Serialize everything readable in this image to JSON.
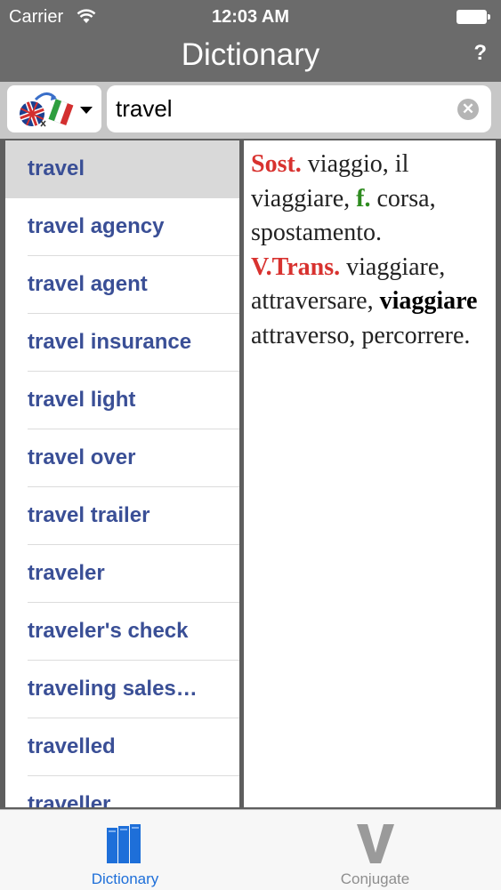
{
  "status": {
    "carrier": "Carrier",
    "time": "12:03 AM"
  },
  "nav": {
    "title": "Dictionary",
    "help_label": "?"
  },
  "search": {
    "value": "travel",
    "clear_label": "✕"
  },
  "word_list": [
    "travel",
    "travel agency",
    "travel agent",
    "travel insurance",
    "travel light",
    "travel over",
    "travel trailer",
    "traveler",
    "traveler's check",
    "traveling sales…",
    "travelled",
    "traveller"
  ],
  "definition": {
    "pos1": "Sost.",
    "text1": " viaggio, il viaggiare, ",
    "gender": "f.",
    "text2": " corsa, spostamento.",
    "pos2": "V.Trans.",
    "text3": " viaggiare, attraversare, ",
    "bold_phrase": "viaggiare",
    "text4": " attraverso, percorrere."
  },
  "tabs": {
    "dictionary": "Dictionary",
    "conjugate": "Conjugate"
  },
  "colors": {
    "accent": "#1e6fd9",
    "word": "#3a4f96",
    "pos_red": "#d8322f",
    "pos_green": "#2e8b1f"
  }
}
